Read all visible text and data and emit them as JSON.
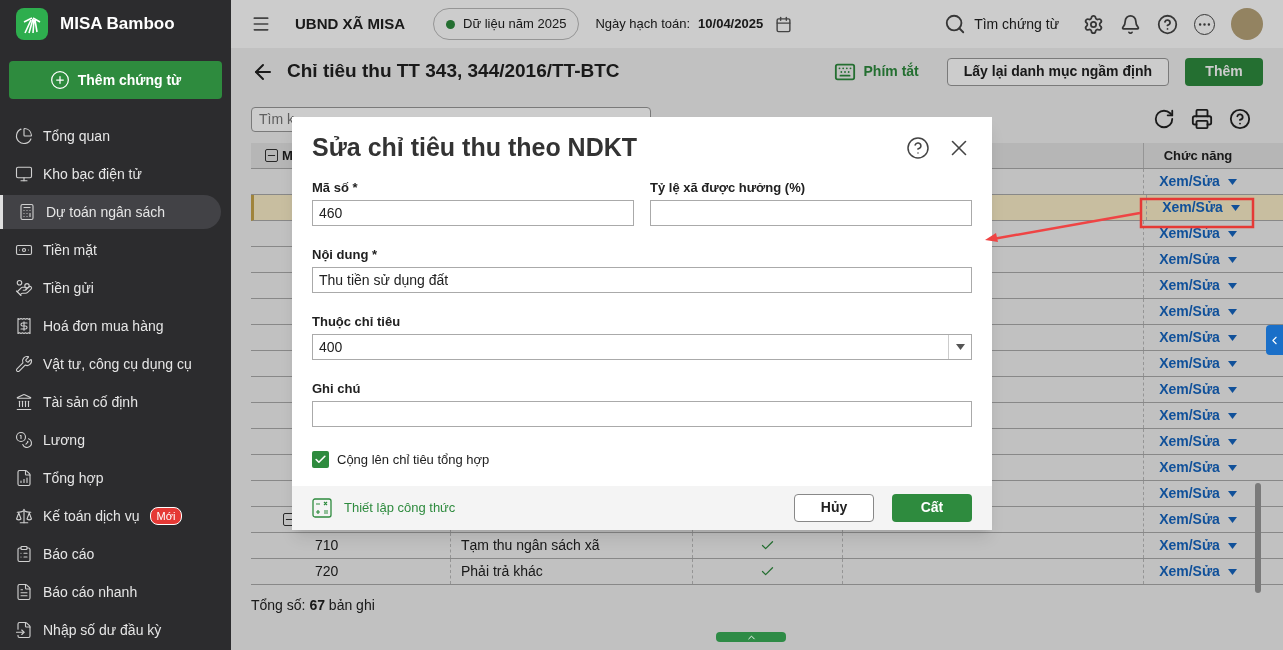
{
  "app": {
    "name": "MISA Bamboo"
  },
  "sidebar": {
    "add_button": "Thêm chứng từ",
    "items": [
      {
        "label": "Tổng quan",
        "selected": false
      },
      {
        "label": "Kho bạc điện tử",
        "selected": false
      },
      {
        "label": "Dự toán ngân sách",
        "selected": true
      },
      {
        "label": "Tiền mặt",
        "selected": false
      },
      {
        "label": "Tiền gửi",
        "selected": false
      },
      {
        "label": "Hoá đơn mua hàng",
        "selected": false
      },
      {
        "label": "Vật tư, công cụ dụng cụ",
        "selected": false
      },
      {
        "label": "Tài sản cố định",
        "selected": false
      },
      {
        "label": "Lương",
        "selected": false
      },
      {
        "label": "Tổng hợp",
        "selected": false
      },
      {
        "label": "Kế toán dịch vụ",
        "selected": false,
        "badge": "Mới"
      },
      {
        "label": "Báo cáo",
        "selected": false
      },
      {
        "label": "Báo cáo nhanh",
        "selected": false
      },
      {
        "label": "Nhập số dư đầu kỳ",
        "selected": false
      }
    ]
  },
  "topbar": {
    "org": "UBND XÃ MISA",
    "data_year": "Dữ liệu năm 2025",
    "date_label": "Ngày hạch toán:",
    "date": "10/04/2025",
    "search": "Tìm chứng từ"
  },
  "page": {
    "title": "Chỉ tiêu thu TT 343, 344/2016/TT-BTC",
    "shortcut": "Phím tắt",
    "reset_button": "Lấy lại danh mục ngầm định",
    "add_button": "Thêm",
    "search_placeholder": "Tìm k",
    "table": {
      "columns": [
        "M",
        "Chức năng"
      ],
      "rows": [
        {
          "action": "Xem/Sửa",
          "selected": false
        },
        {
          "action": "Xem/Sửa",
          "selected": true
        },
        {
          "action": "Xem/Sửa",
          "selected": false
        },
        {
          "action": "Xem/Sửa",
          "selected": false
        },
        {
          "action": "Xem/Sửa",
          "selected": false
        },
        {
          "action": "Xem/Sửa",
          "selected": false
        },
        {
          "action": "Xem/Sửa",
          "selected": false
        },
        {
          "action": "Xem/Sửa",
          "selected": false
        },
        {
          "action": "Xem/Sửa",
          "selected": false
        },
        {
          "action": "Xem/Sửa",
          "selected": false
        },
        {
          "action": "Xem/Sửa",
          "selected": false
        },
        {
          "action": "Xem/Sửa",
          "selected": false
        },
        {
          "action": "Xem/Sửa",
          "selected": false
        },
        {
          "action": "Xem/Sửa",
          "selected": false,
          "kind": "group"
        },
        {
          "code": "710",
          "name": "Tạm thu ngân sách xã",
          "checked": true,
          "action": "Xem/Sửa",
          "selected": false
        },
        {
          "code": "720",
          "name": "Phải trả khác",
          "checked": true,
          "action": "Xem/Sửa",
          "selected": false
        }
      ]
    },
    "total_label": "Tổng số:",
    "total_count": "67",
    "total_unit": "bản ghi"
  },
  "dialog": {
    "title": "Sửa chỉ tiêu thu theo NDKT",
    "fields": [
      {
        "label": "Mã số *",
        "value": "460",
        "kind": "text"
      },
      {
        "label": "Tỷ lệ xã được hưởng (%)",
        "kind": "text"
      },
      {
        "label": "Nội dung *",
        "value": "Thu tiền sử dụng đất",
        "kind": "text"
      },
      {
        "label": "Thuộc chỉ tiêu",
        "value": "400",
        "kind": "select"
      },
      {
        "label": "Ghi chú",
        "kind": "text"
      }
    ],
    "checkbox": {
      "label": "Cộng lên chỉ tiêu tổng hợp",
      "checked": true
    },
    "formula_link": "Thiết lập công thức",
    "cancel": "Hủy",
    "save": "Cất"
  }
}
